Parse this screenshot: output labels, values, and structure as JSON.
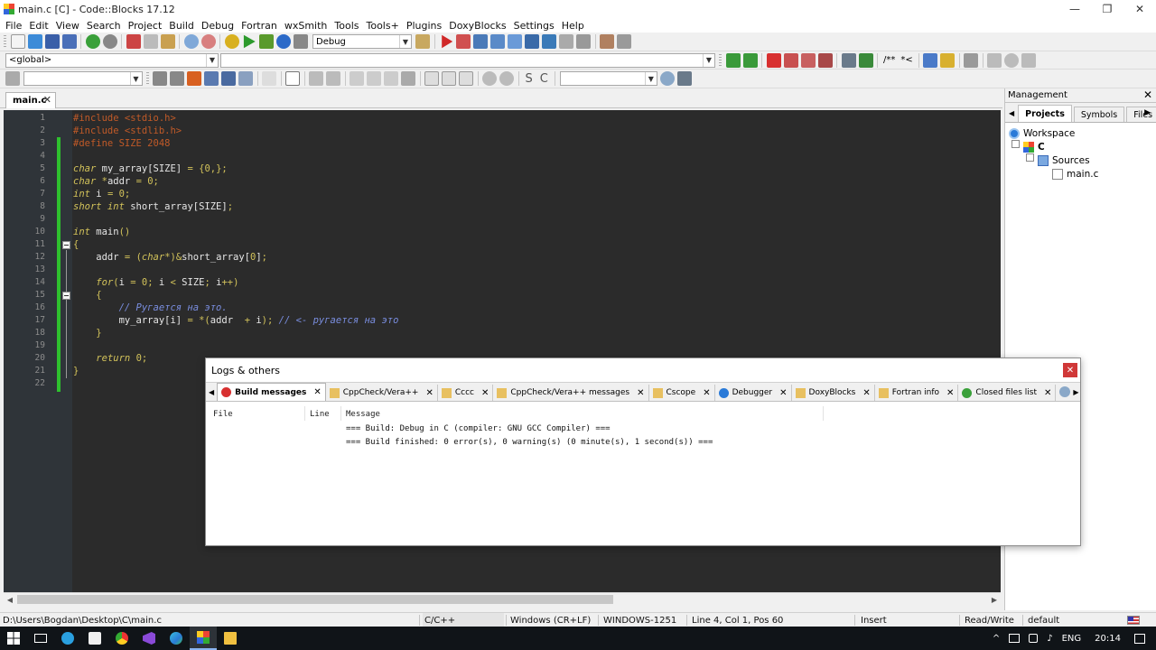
{
  "window": {
    "title": "main.c [C] - Code::Blocks 17.12",
    "minimize": "—",
    "maximize": "❐",
    "close": "✕"
  },
  "menu": [
    "File",
    "Edit",
    "View",
    "Search",
    "Project",
    "Build",
    "Debug",
    "Fortran",
    "wxSmith",
    "Tools",
    "Tools+",
    "Plugins",
    "DoxyBlocks",
    "Settings",
    "Help"
  ],
  "toolbar": {
    "build_target": "Debug",
    "scope": "<global>",
    "function": "",
    "search_text": "",
    "doxy_comment": "/**",
    "doxy_inline": "*<",
    "regex_s": "S",
    "regex_c": "C"
  },
  "editor": {
    "tab_label": "main.c",
    "tab_close": "✕",
    "line_numbers": [
      "1",
      "2",
      "3",
      "4",
      "5",
      "6",
      "7",
      "8",
      "9",
      "10",
      "11",
      "12",
      "13",
      "14",
      "15",
      "16",
      "17",
      "18",
      "19",
      "20",
      "21",
      "22"
    ]
  },
  "management": {
    "title": "Management",
    "close": "✕",
    "tabs": [
      "Projects",
      "Symbols",
      "Files"
    ],
    "tree": {
      "workspace": "Workspace",
      "project": "C",
      "folder": "Sources",
      "file": "main.c"
    }
  },
  "logs": {
    "title": "Logs & others",
    "close": "✕",
    "tabs": [
      "Build messages",
      "CppCheck/Vera++",
      "Cccc",
      "CppCheck/Vera++ messages",
      "Cscope",
      "Debugger",
      "DoxyBlocks",
      "Fortran info",
      "Closed files list"
    ],
    "columns": {
      "file": "File",
      "line": "Line",
      "message": "Message"
    },
    "messages": [
      "=== Build: Debug in C (compiler: GNU GCC Compiler) ===",
      "=== Build finished: 0 error(s), 0 warning(s) (0 minute(s), 1 second(s)) ==="
    ]
  },
  "status": {
    "path": "D:\\Users\\Bogdan\\Desktop\\C\\main.c",
    "language": "C/C++",
    "line_endings": "Windows (CR+LF)",
    "encoding": "WINDOWS-1251",
    "position": "Line 4, Col 1, Pos 60",
    "mode": "Insert",
    "access": "Read/Write",
    "profile": "default"
  },
  "taskbar": {
    "lang": "ENG",
    "time": "20:14"
  },
  "colors": {
    "editor_bg": "#2b2b2b",
    "gutter_bg": "#2f3439",
    "change_bar": "#2ec02e",
    "preprocessor": "#c05a28",
    "keyword": "#d2c25a",
    "comment": "#7a8ee0",
    "logs_close": "#d03838"
  }
}
